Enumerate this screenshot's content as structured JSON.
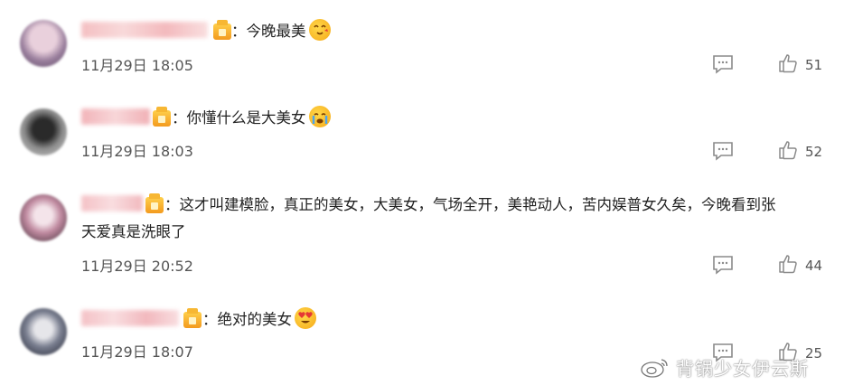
{
  "comments": [
    {
      "text": "：今晚最美",
      "emoji": "heart-eyes-kiss-emoji",
      "time": "11月29日 18:05",
      "likes": "51"
    },
    {
      "text": "：你懂什么是大美女",
      "emoji": "crying-emoji",
      "time": "11月29日 18:03",
      "likes": "52"
    },
    {
      "text_line1": "：这才叫建模脸，真正的美女，大美女，气场全开，美艳动人，苦内娱普女久矣，今晚看到张",
      "text_line2": "天爱真是洗眼了",
      "time": "11月29日 20:52",
      "likes": "44"
    },
    {
      "text": "：绝对的美女",
      "emoji": "heart-eyes-emoji",
      "time": "11月29日 18:07",
      "likes": "25"
    }
  ],
  "watermark": "背锅少女伊云斯",
  "colors": {
    "vip": "#f7b733",
    "icon": "#999999"
  }
}
